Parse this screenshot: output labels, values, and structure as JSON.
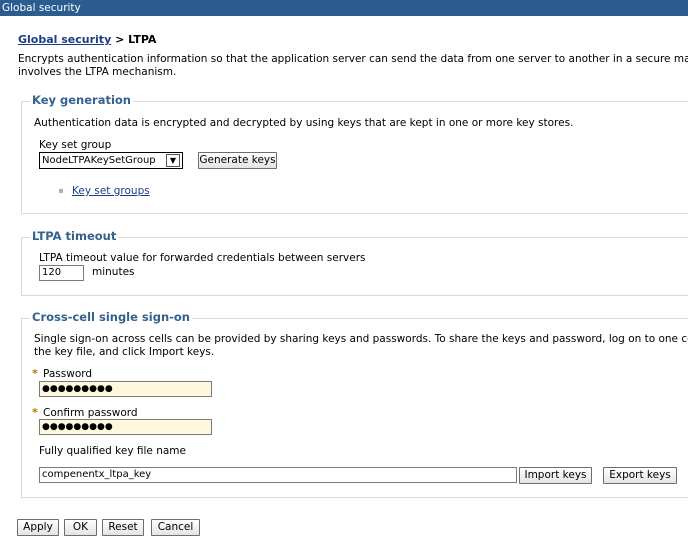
{
  "window": {
    "title": "Global security"
  },
  "breadcrumb": {
    "parent": "Global security",
    "separator": " > ",
    "current": "LTPA"
  },
  "description": {
    "line1": "Encrypts authentication information so that the application server can send the data from one server to another in a secure manner.",
    "line2": "involves the LTPA mechanism."
  },
  "key_generation": {
    "title": "Key generation",
    "text": "Authentication data is encrypted and decrypted by using keys that are kept in one or more key stores.",
    "key_set_group_label": "Key set group",
    "key_set_group_value": "NodeLTPAKeySetGroup",
    "generate_keys_label": "Generate keys",
    "key_set_groups_link": "Key set groups"
  },
  "ltpa_timeout": {
    "title": "LTPA timeout",
    "label": "LTPA timeout value for forwarded credentials between servers",
    "value": "120",
    "unit": "minutes"
  },
  "cross_cell": {
    "title": "Cross-cell single sign-on",
    "text_line1": "Single sign-on across cells can be provided by sharing keys and passwords. To share the keys and password, log on to one cell, s",
    "text_line2": "the key file, and click Import keys.",
    "required_marker": "*",
    "password_label": "Password",
    "password_value": "●●●●●●●●●",
    "confirm_label": "Confirm password",
    "confirm_value": "●●●●●●●●●",
    "key_file_label": "Fully qualified key file name",
    "key_file_value": "compenentx_ltpa_key",
    "import_label": "Import keys",
    "export_label": "Export keys"
  },
  "actions": {
    "apply": "Apply",
    "ok": "OK",
    "reset": "Reset",
    "cancel": "Cancel"
  }
}
